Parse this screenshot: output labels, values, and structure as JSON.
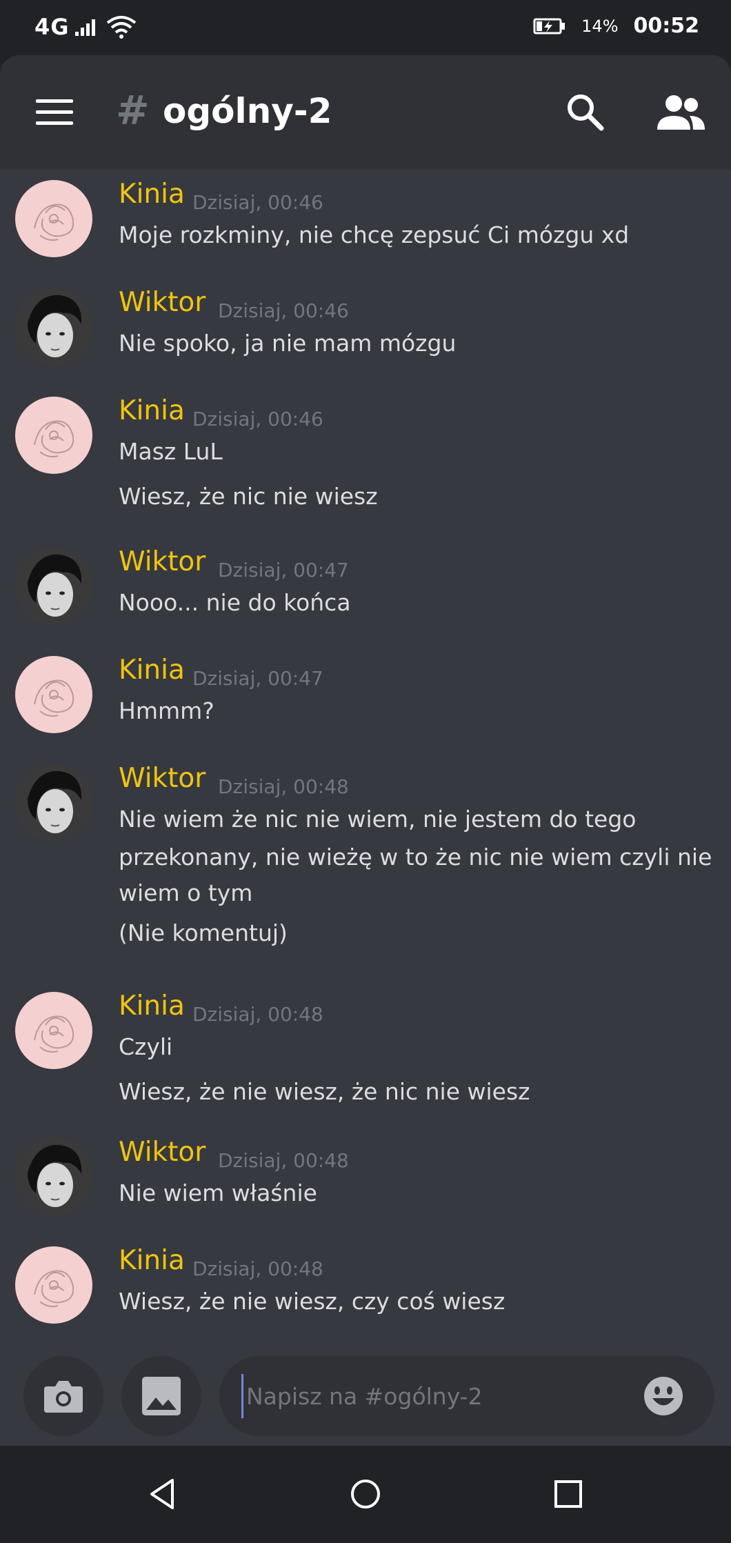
{
  "status_bar": {
    "network": "4G",
    "battery_percent": "14%",
    "time": "00:52",
    "icons": [
      "signal-icon",
      "wifi-icon",
      "battery-charging-icon"
    ]
  },
  "header": {
    "channel_hash": "#",
    "channel_name": "ogólny-2",
    "icons": [
      "hamburger-menu-icon",
      "search-icon",
      "members-icon"
    ]
  },
  "messages": [
    {
      "author": "Kinia",
      "avatar": "kinia-avatar",
      "time": "Dzisiaj, 00:46",
      "lines": [
        "Moje rozkminy, nie chcę zepsuć Ci mózgu xd"
      ]
    },
    {
      "author": "Wiktor",
      "avatar": "wiktor-avatar",
      "time": "Dzisiaj, 00:46",
      "lines": [
        "Nie spoko, ja nie mam mózgu"
      ]
    },
    {
      "author": "Kinia",
      "avatar": "kinia-avatar",
      "time": "Dzisiaj, 00:46",
      "lines": [
        "Masz LuL",
        "Wiesz, że nic nie wiesz"
      ]
    },
    {
      "author": "Wiktor",
      "avatar": "wiktor-avatar",
      "time": "Dzisiaj, 00:47",
      "lines": [
        "Nooo... nie do końca"
      ]
    },
    {
      "author": "Kinia",
      "avatar": "kinia-avatar",
      "time": "Dzisiaj, 00:47",
      "lines": [
        "Hmmm?"
      ]
    },
    {
      "author": "Wiktor",
      "avatar": "wiktor-avatar",
      "time": "Dzisiaj, 00:48",
      "lines": [
        "Nie wiem że nic nie wiem, nie jestem do tego",
        "przekonany, nie wieżę w to że nic nie wiem czyli nie",
        "wiem o tym",
        "(Nie komentuj)"
      ]
    },
    {
      "author": "Kinia",
      "avatar": "kinia-avatar",
      "time": "Dzisiaj, 00:48",
      "lines": [
        "Czyli",
        "Wiesz, że nie wiesz, że nic nie wiesz"
      ]
    },
    {
      "author": "Wiktor",
      "avatar": "wiktor-avatar",
      "time": "Dzisiaj, 00:48",
      "lines": [
        "Nie wiem właśnie"
      ]
    },
    {
      "author": "Kinia",
      "avatar": "kinia-avatar",
      "time": "Dzisiaj, 00:48",
      "lines": [
        "Wiesz, że nie wiesz, czy coś wiesz"
      ]
    }
  ],
  "composer": {
    "placeholder": "Napisz na #ogólny-2",
    "icons": [
      "camera-icon",
      "image-icon",
      "emoji-icon"
    ]
  },
  "nav_bar": {
    "icons": [
      "back-icon",
      "home-icon",
      "recents-icon"
    ]
  },
  "colors": {
    "background": "#36393f",
    "header": "#2f3136",
    "author": "#f1c40f",
    "text": "#dcddde",
    "muted": "#72767d",
    "accent": "#7289da"
  }
}
